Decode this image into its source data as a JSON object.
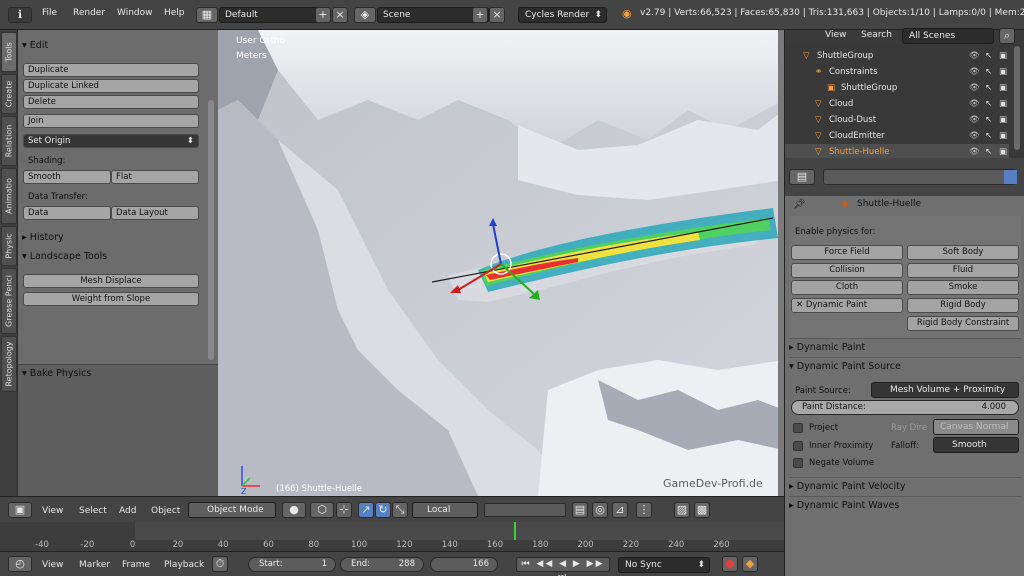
{
  "topbar": {
    "menus": [
      "File",
      "Render",
      "Window",
      "Help"
    ],
    "layout": "Default",
    "scene": "Scene",
    "engine": "Cycles Render",
    "stats": "v2.79 | Verts:66,523 | Faces:65,830 | Tris:131,663 | Objects:1/10 | Lamps:0/0 | Mem:238.73M"
  },
  "tabs": [
    "Tools",
    "Create",
    "Relation",
    "Animatio",
    "Physic",
    "Grease Penci",
    "Retopology"
  ],
  "toolshelf": {
    "edit_header": "Edit",
    "duplicate": "Duplicate",
    "duplicate_linked": "Duplicate Linked",
    "delete": "Delete",
    "join": "Join",
    "set_origin": "Set Origin",
    "shading_label": "Shading:",
    "smooth": "Smooth",
    "flat": "Flat",
    "data_transfer_label": "Data Transfer:",
    "data": "Data",
    "data_layout": "Data Layout",
    "history_header": "History",
    "landscape_header": "Landscape Tools",
    "mesh_displace": "Mesh Displace",
    "weight_from_slope": "Weight from Slope",
    "bake_header": "Bake Physics"
  },
  "viewport": {
    "view_name": "User Ortho",
    "units": "Meters",
    "object_label": "(166) Shuttle-Huelle",
    "watermark": "GameDev-Profi.de"
  },
  "view3d_header": {
    "menus": [
      "View",
      "Select",
      "Add",
      "Object"
    ],
    "mode": "Object Mode",
    "orientation": "Local"
  },
  "timeline": {
    "ticks": [
      "-40",
      "-20",
      "0",
      "20",
      "40",
      "60",
      "80",
      "100",
      "120",
      "140",
      "160",
      "180",
      "200",
      "220",
      "240",
      "260"
    ],
    "current_frame_fraction": 0.627,
    "menus": [
      "View",
      "Marker",
      "Frame",
      "Playback"
    ],
    "start_label": "Start:",
    "start": "1",
    "end_label": "End:",
    "end": "288",
    "current": "166",
    "sync": "No Sync"
  },
  "outliner": {
    "view": "View",
    "search": "Search",
    "filter": "All Scenes",
    "rows": [
      "ShuttleGroup",
      "Constraints",
      "ShuttleGroup",
      "Cloud",
      "Cloud-Dust",
      "CloudEmitter",
      "Shuttle-Huelle"
    ]
  },
  "properties": {
    "object": "Shuttle-Huelle",
    "enable_label": "Enable physics for:",
    "force_field": "Force Field",
    "soft_body": "Soft Body",
    "collision": "Collision",
    "fluid": "Fluid",
    "cloth": "Cloth",
    "smoke": "Smoke",
    "dynamic_paint": "Dynamic Paint",
    "rigid_body": "Rigid Body",
    "rigid_body_constraint": "Rigid Body Constraint",
    "dp_header": "Dynamic Paint",
    "dp_source_header": "Dynamic Paint Source",
    "paint_source_label": "Paint Source:",
    "paint_source": "Mesh Volume + Proximity",
    "paint_distance_label": "Paint Distance:",
    "paint_distance": "4.000",
    "project": "Project",
    "ray_dir_label": "Ray Dire",
    "ray_dir": "Canvas Normal",
    "inner_proximity": "Inner Proximity",
    "falloff_label": "Falloff:",
    "falloff": "Smooth",
    "negate_volume": "Negate Volume",
    "velocity_header": "Dynamic Paint Velocity",
    "waves_header": "Dynamic Paint Waves"
  },
  "colors": {
    "accent_blue": "#5680c2",
    "selected_orange": "#f0a040"
  }
}
